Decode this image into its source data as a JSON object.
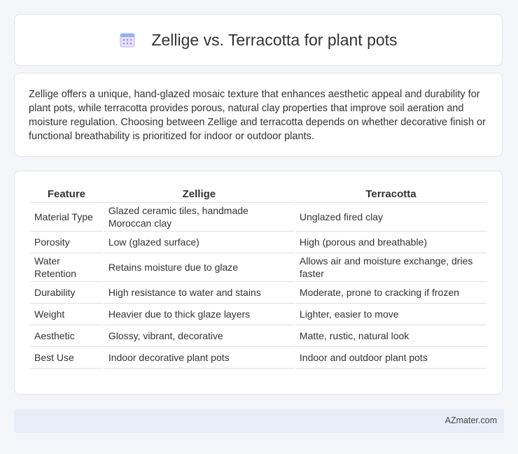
{
  "header": {
    "title": "Zellige vs. Terracotta for plant pots",
    "icon": "calendar-grid-icon",
    "icon_color": "#8a7bd6"
  },
  "intro": {
    "text": "Zellige offers a unique, hand-glazed mosaic texture that enhances aesthetic appeal and durability for plant pots, while terracotta provides porous, natural clay properties that improve soil aeration and moisture regulation. Choosing between Zellige and terracotta depends on whether decorative finish or functional breathability is prioritized for indoor or outdoor plants."
  },
  "table": {
    "headers": [
      "Feature",
      "Zellige",
      "Terracotta"
    ],
    "rows": [
      [
        "Material Type",
        "Glazed ceramic tiles, handmade Moroccan clay",
        "Unglazed fired clay"
      ],
      [
        "Porosity",
        "Low (glazed surface)",
        "High (porous and breathable)"
      ],
      [
        "Water Retention",
        "Retains moisture due to glaze",
        "Allows air and moisture exchange, dries faster"
      ],
      [
        "Durability",
        "High resistance to water and stains",
        "Moderate, prone to cracking if frozen"
      ],
      [
        "Weight",
        "Heavier due to thick glaze layers",
        "Lighter, easier to move"
      ],
      [
        "Aesthetic",
        "Glossy, vibrant, decorative",
        "Matte, rustic, natural look"
      ],
      [
        "Best Use",
        "Indoor decorative plant pots",
        "Indoor and outdoor plant pots"
      ]
    ]
  },
  "footer": {
    "brand": "AZmater.com"
  }
}
